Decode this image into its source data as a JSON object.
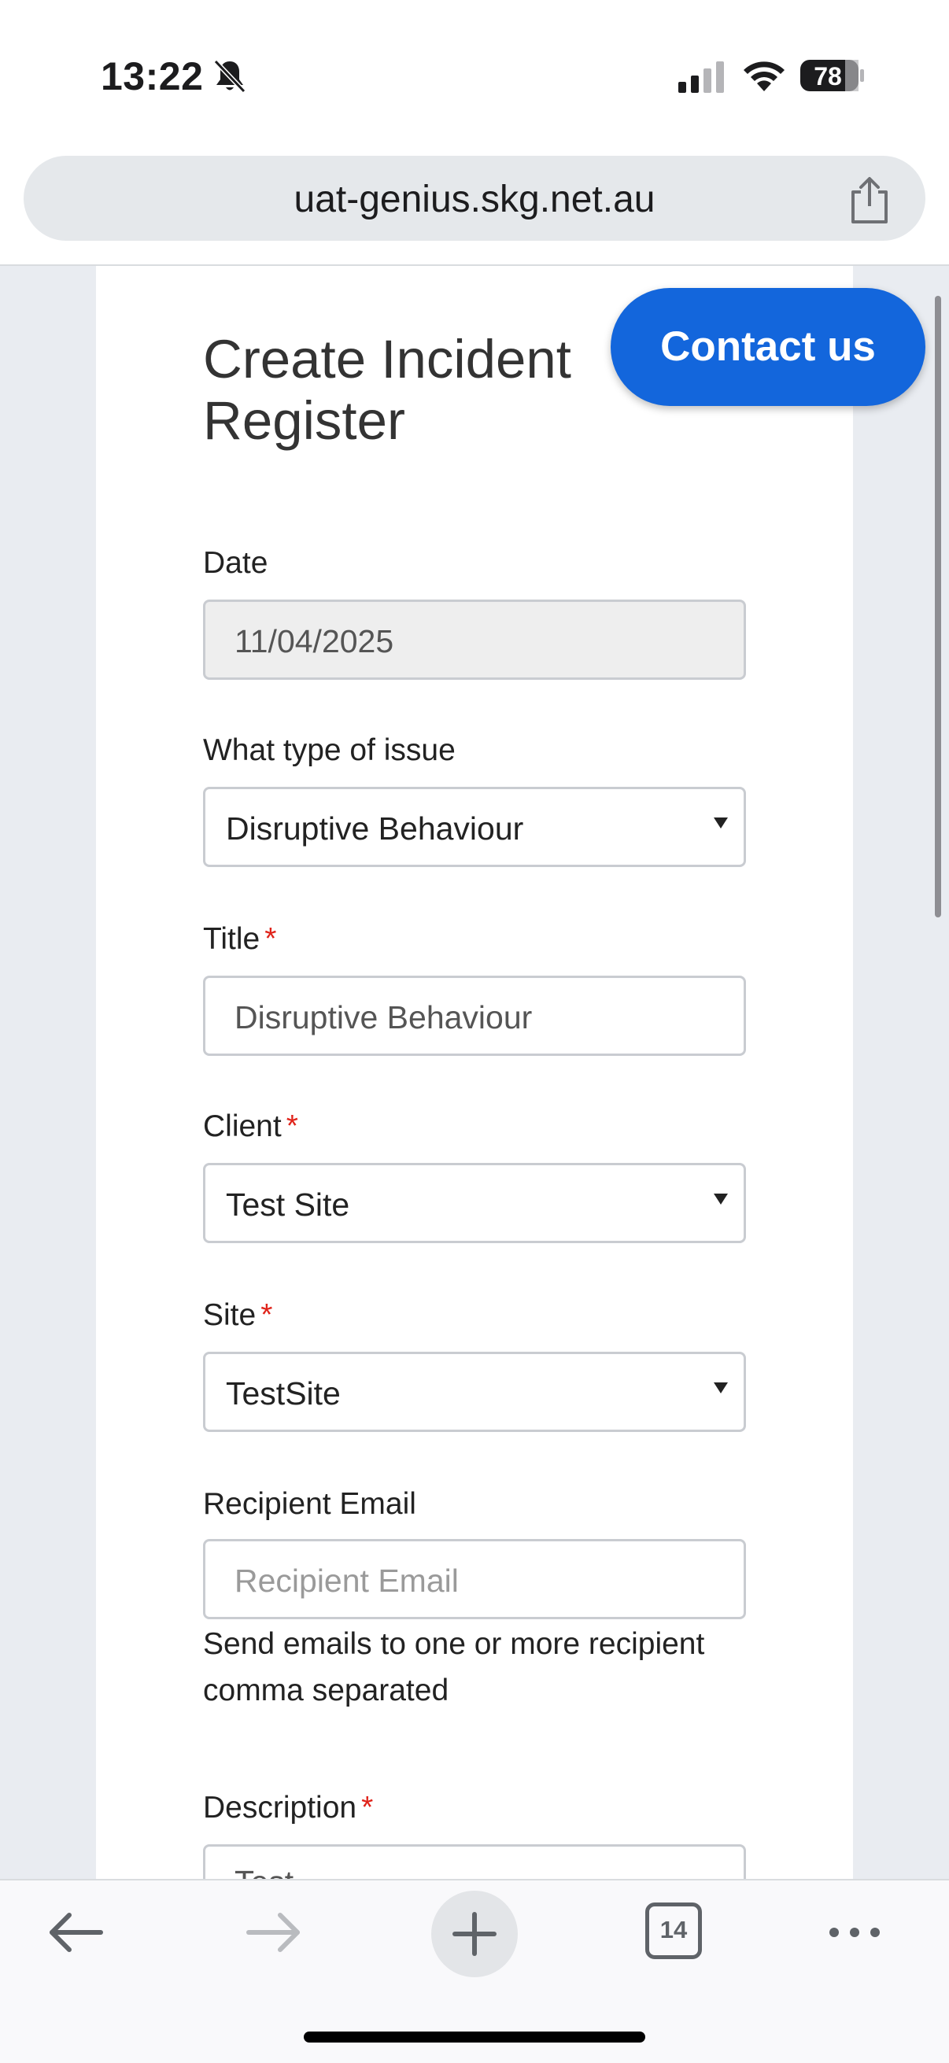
{
  "status_bar": {
    "time": "13:22",
    "battery": "78",
    "icons": [
      "bell-slash-icon",
      "cellular-signal-icon",
      "wifi-icon",
      "battery-icon"
    ]
  },
  "browser": {
    "url": "uat-genius.skg.net.au",
    "tab_count": "14",
    "toolbar_icons": [
      "back-arrow-icon",
      "forward-arrow-icon",
      "plus-icon",
      "tabs-icon",
      "more-icon"
    ]
  },
  "page": {
    "title": "Create Incident Register",
    "contact_label": "Contact us",
    "required_marker": "*",
    "fields": {
      "date": {
        "label": "Date",
        "value": "11/04/2025"
      },
      "issue_type": {
        "label": "What type of issue",
        "value": "Disruptive Behaviour"
      },
      "title": {
        "label": "Title",
        "value": "Disruptive Behaviour"
      },
      "client": {
        "label": "Client",
        "value": "Test Site"
      },
      "site": {
        "label": "Site",
        "value": "TestSite"
      },
      "recipient_email": {
        "label": "Recipient Email",
        "placeholder": "Recipient Email",
        "helper": "Send emails to one or more recipient comma separated"
      },
      "description": {
        "label": "Description",
        "value": "Test"
      }
    }
  },
  "colors": {
    "accent": "#1366dc",
    "required": "#e0231a",
    "page_background": "#e9ecf1"
  }
}
